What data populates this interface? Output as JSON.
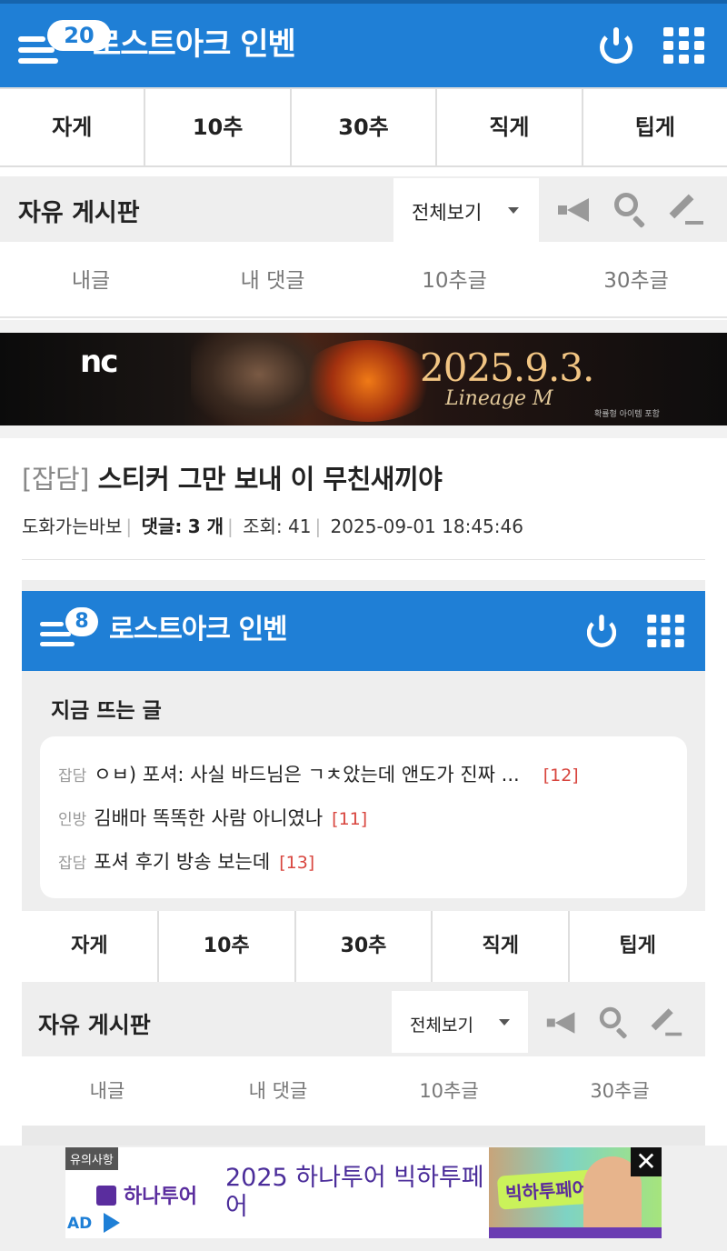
{
  "header": {
    "badge": "20",
    "title": "로스트아크 인벤"
  },
  "tabs": [
    "자게",
    "10추",
    "30추",
    "직게",
    "팁게"
  ],
  "board": {
    "name": "자유 게시판",
    "filter": "전체보기",
    "subnav": [
      "내글",
      "내 댓글",
      "10추글",
      "30추글"
    ]
  },
  "banner": {
    "brand": "nc",
    "date": "2025.9.3.",
    "product": "Lineage M",
    "fine_print": "확률형 아이템 포함"
  },
  "post": {
    "category": "[잡담]",
    "title": "스티커 그만 보내 이 무친새끼야",
    "author": "도화가는바보",
    "comments_label": "댓글:",
    "comments_count": "3 개",
    "views_label": "조회:",
    "views": "41",
    "datetime": "2025-09-01 18:45:46"
  },
  "embedded": {
    "header": {
      "badge": "8",
      "title": "로스트아크 인벤"
    },
    "hot_title": "지금 뜨는 글",
    "hot_posts": [
      {
        "cat": "잡담",
        "title": "ㅇㅂ) 포셔: 사실 바드님은 ㄱㅊ았는데 앤도가 진짜 ...",
        "count": "[12]"
      },
      {
        "cat": "인방",
        "title": "김배마 똑똑한 사람 아니였나",
        "count": "[11]"
      },
      {
        "cat": "잡담",
        "title": "포셔 후기 방송 보는데",
        "count": "[13]"
      }
    ],
    "tabs": [
      "자게",
      "10추",
      "30추",
      "직게",
      "팁게"
    ],
    "board": {
      "name": "자유 게시판",
      "filter": "전체보기",
      "subnav": [
        "내글",
        "내 댓글",
        "10추글",
        "30추글"
      ]
    }
  },
  "ad": {
    "warning": "유의사항",
    "brand": "하나투어",
    "headline": "2025 하나투어 빅하투페어",
    "ad_label": "AD",
    "image_badge": "빅하투페어",
    "close": "✕"
  },
  "colors": {
    "brand_blue": "#1f7fd6",
    "count_red": "#d8453e",
    "ad_purple": "#4b2d9a"
  }
}
